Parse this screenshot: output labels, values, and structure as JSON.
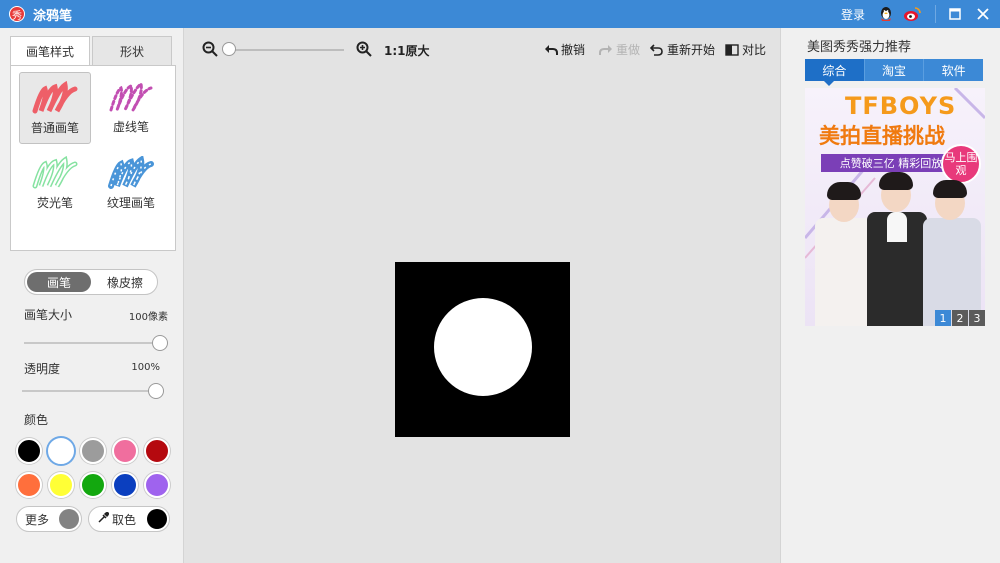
{
  "window": {
    "title": "涂鸦笔",
    "logo_text": "秀",
    "login": "登录",
    "icons": [
      "qq-icon",
      "weibo-icon"
    ],
    "controls": [
      "maximize-icon",
      "close-icon"
    ]
  },
  "left_panel": {
    "tabs": [
      {
        "label": "画笔样式",
        "active": true
      },
      {
        "label": "形状",
        "active": false
      }
    ],
    "brushes": [
      {
        "label": "普通画笔",
        "selected": true,
        "color": "#ee5f68"
      },
      {
        "label": "虚线笔",
        "selected": false,
        "color": "#c24fb2"
      },
      {
        "label": "荧光笔",
        "selected": false,
        "color": "#86e2a1"
      },
      {
        "label": "纹理画笔",
        "selected": false,
        "color": "#4a95d8"
      }
    ],
    "mode": {
      "brush": "画笔",
      "eraser": "橡皮擦",
      "active": "brush"
    },
    "brush_size": {
      "label": "画笔大小",
      "value": "100像素",
      "level": 1.0
    },
    "opacity": {
      "label": "透明度",
      "value": "100%",
      "level": 1.0
    },
    "color_label": "颜色",
    "colors": [
      "#000000",
      "#ffffff",
      "#9c9c9c",
      "#f06e9e",
      "#b5090f",
      "#ff6f3c",
      "#ffff36",
      "#13a80f",
      "#0b3fbf",
      "#9f63ee"
    ],
    "selected_color_index": 1,
    "more": {
      "label": "更多",
      "color": "#838383"
    },
    "picker": {
      "label": "取色",
      "color": "#000000"
    }
  },
  "toolbar": {
    "zoom_level": 0.0,
    "original_size": "1:1原大",
    "undo": "撤销",
    "redo": "重做",
    "restart": "重新开始",
    "compare": "对比"
  },
  "canvas": {
    "background": "#000000",
    "shape_color": "#ffffff"
  },
  "right_panel": {
    "title": "美图秀秀强力推荐",
    "tabs": [
      {
        "label": "综合",
        "active": true
      },
      {
        "label": "淘宝",
        "active": false
      },
      {
        "label": "软件",
        "active": false
      }
    ],
    "ad": {
      "headline1": "TFBOYS",
      "headline2": "美拍直播挑战",
      "strip": "点赞破三亿 精彩回放",
      "badge": "马上围观"
    },
    "pages": [
      "1",
      "2",
      "3"
    ],
    "active_page": 0
  }
}
